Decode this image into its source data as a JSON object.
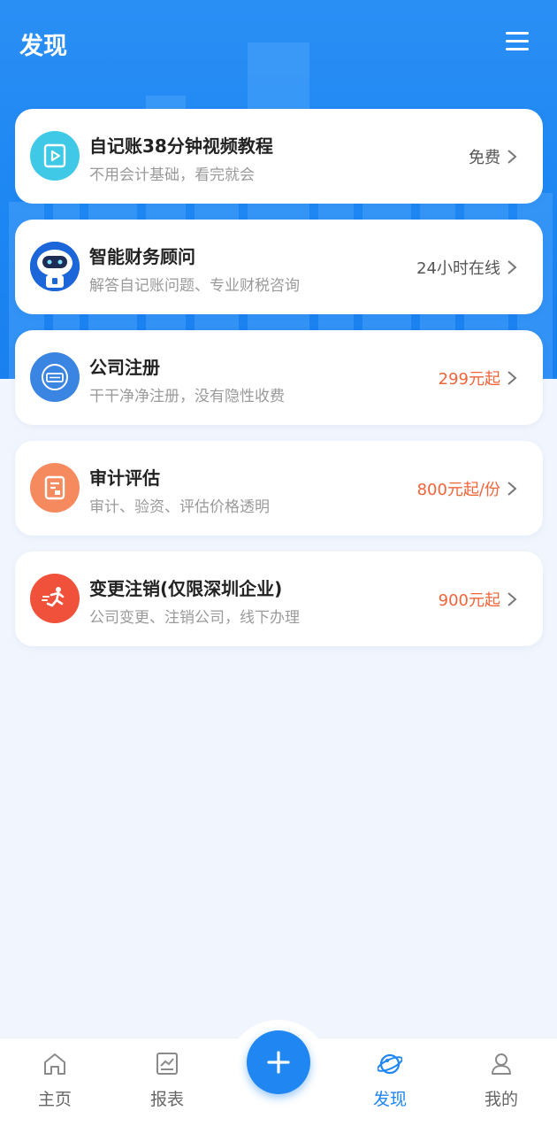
{
  "header": {
    "title": "发现",
    "menu_icon": "menu-icon"
  },
  "colors": {
    "primary": "#1f86f2",
    "price": "#f0643a",
    "muted": "#9a9a9a"
  },
  "cards": [
    {
      "title": "自记账38分钟视频教程",
      "subtitle": "不用会计基础，看完就会",
      "right": "免费",
      "icon": "video-icon",
      "right_color": "#555555"
    },
    {
      "title": "智能财务顾问",
      "subtitle": "解答自记账问题、专业财税咨询",
      "right": "24小时在线",
      "icon": "robot-icon",
      "right_color": "#555555"
    },
    {
      "title": "公司注册",
      "subtitle": "干干净净注册，没有隐性收费",
      "right": "299元起",
      "icon": "registration-stamp-icon",
      "right_color": "#f0643a"
    },
    {
      "title": "审计评估",
      "subtitle": "审计、验资、评估价格透明",
      "right": "800元起/份",
      "icon": "audit-document-icon",
      "right_color": "#f0643a"
    },
    {
      "title": "变更注销(仅限深圳企业)",
      "subtitle": "公司变更、注销公司，线下办理",
      "right": "900元起",
      "icon": "running-man-icon",
      "right_color": "#f0643a"
    }
  ],
  "tabbar": {
    "items": [
      {
        "label": "主页",
        "icon": "home-icon",
        "active": false
      },
      {
        "label": "报表",
        "icon": "report-icon",
        "active": false
      },
      {
        "label": "发现",
        "icon": "planet-icon",
        "active": true
      },
      {
        "label": "我的",
        "icon": "user-icon",
        "active": false
      }
    ],
    "add_icon": "plus-icon"
  }
}
